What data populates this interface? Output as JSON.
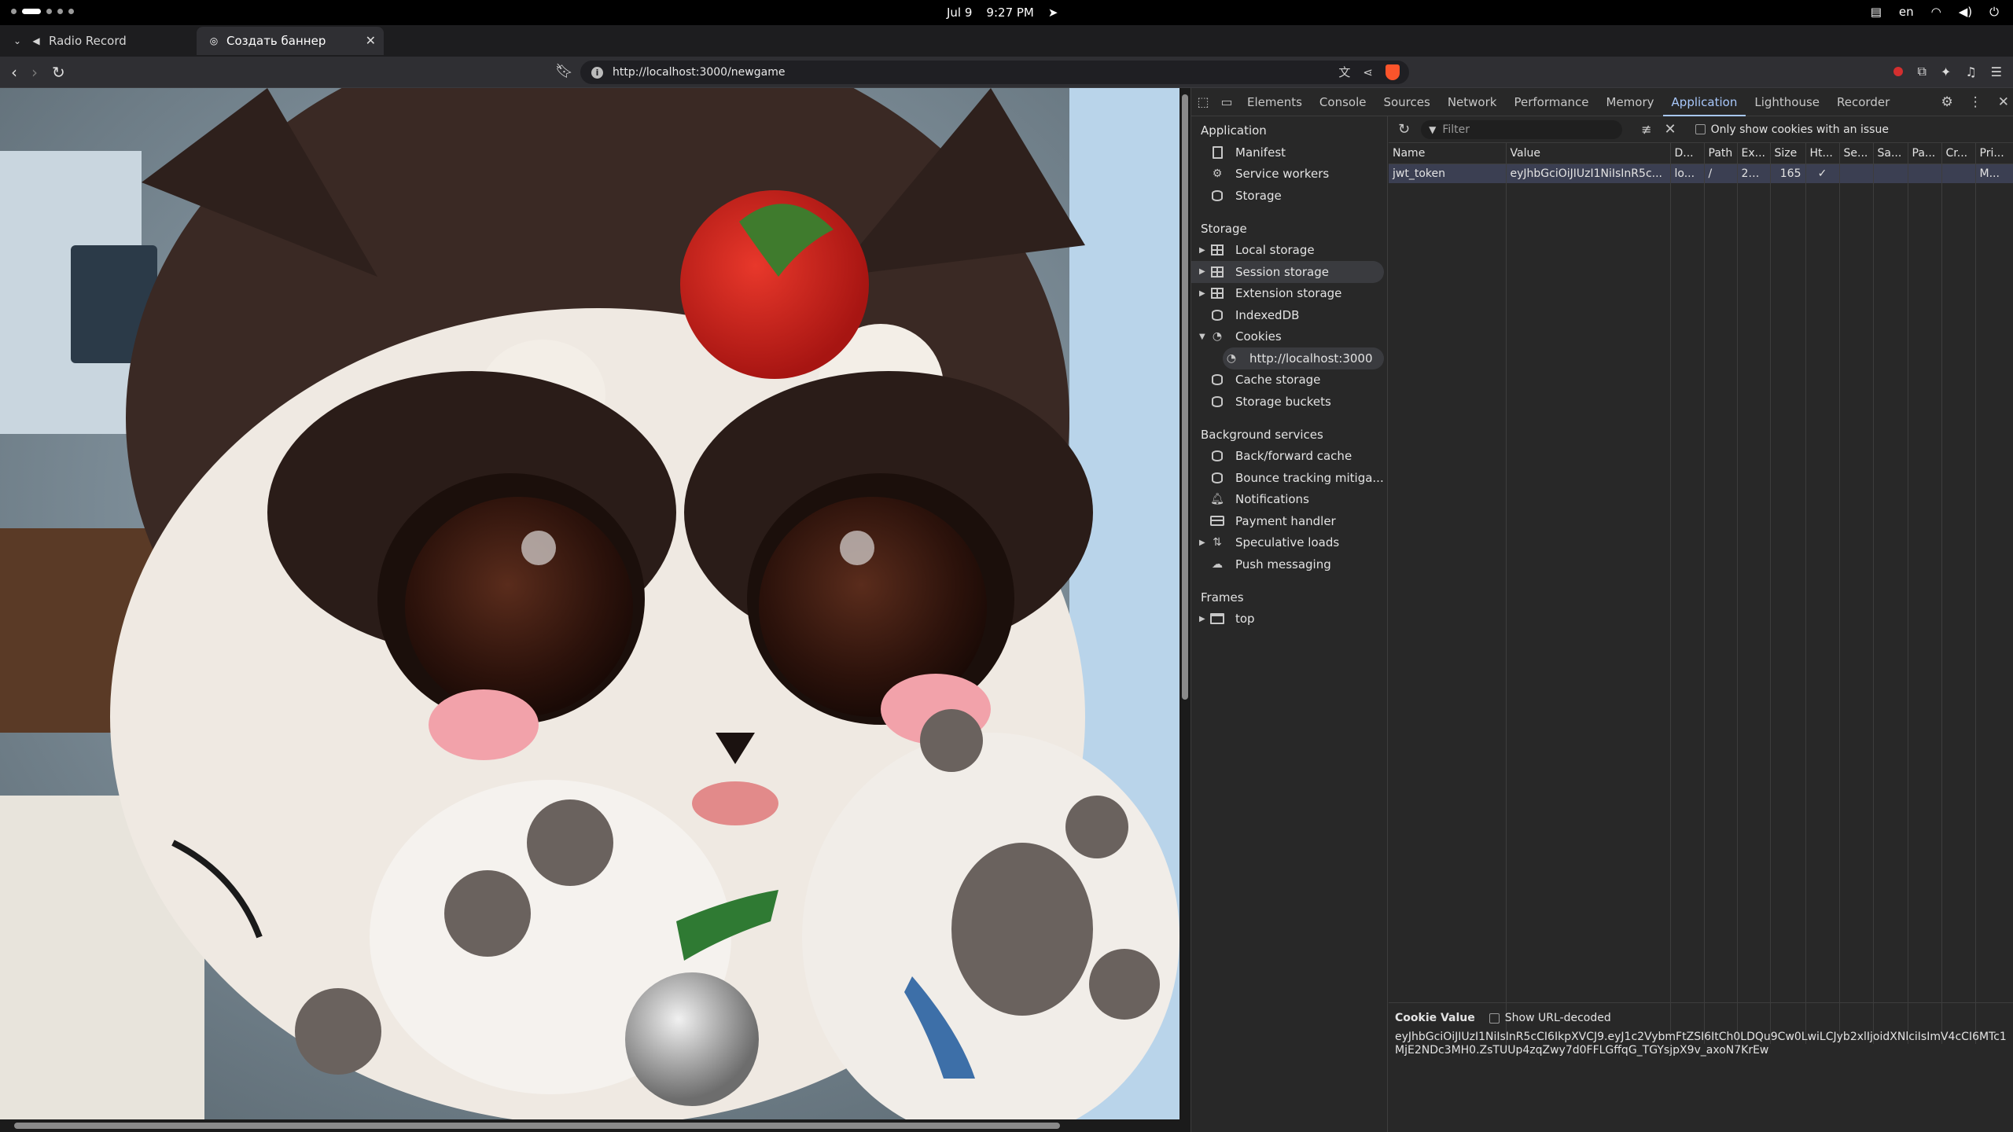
{
  "system_bar": {
    "date": "Jul 9",
    "time": "9:27 PM",
    "language": "en"
  },
  "tabs": [
    {
      "title": "Radio Record",
      "active": false
    },
    {
      "title": "Создать баннер",
      "active": true
    }
  ],
  "address_bar": {
    "url": "http://localhost:3000/newgame"
  },
  "devtools": {
    "tabs": [
      "Elements",
      "Console",
      "Sources",
      "Network",
      "Performance",
      "Memory",
      "Application",
      "Lighthouse",
      "Recorder"
    ],
    "active_tab": "Application",
    "sidebar": {
      "application": {
        "heading": "Application",
        "items": [
          "Manifest",
          "Service workers",
          "Storage"
        ]
      },
      "storage": {
        "heading": "Storage",
        "items": [
          "Local storage",
          "Session storage",
          "Extension storage",
          "IndexedDB",
          "Cookies",
          "http://localhost:3000",
          "Cache storage",
          "Storage buckets"
        ]
      },
      "background": {
        "heading": "Background services",
        "items": [
          "Back/forward cache",
          "Bounce tracking mitiga...",
          "Notifications",
          "Payment handler",
          "Speculative loads",
          "Push messaging"
        ]
      },
      "frames": {
        "heading": "Frames",
        "items": [
          "top"
        ]
      }
    },
    "toolbar": {
      "filter_placeholder": "Filter",
      "only_issues_label": "Only show cookies with an issue"
    },
    "cookie_table": {
      "columns": [
        "Name",
        "Value",
        "D...",
        "Path",
        "Ex...",
        "Size",
        "Ht...",
        "Se...",
        "Sa...",
        "Pa...",
        "Cr...",
        "Pri..."
      ],
      "rows": [
        [
          "jwt_token",
          "eyJhbGciOiJIUzI1NiIsInR5c...",
          "lo...",
          "/",
          "20...",
          "165",
          "✓",
          "",
          "",
          "",
          "",
          "M..."
        ]
      ]
    },
    "cookie_value": {
      "heading": "Cookie Value",
      "show_decoded_label": "Show URL-decoded",
      "value": "eyJhbGciOiJIUzI1NiIsInR5cCI6IkpXVCJ9.eyJ1c2VybmFtZSI6ItCh0LDQu9Cw0LwiLCJyb2xlIjoidXNlciIsImV4cCI6MTc1MjE2NDc3MH0.ZsTUUp4zqZwy7d0FFLGffqG_TGYsjpX9v_axoN7KrEw"
    }
  },
  "colors": {
    "accent": "#a8c7fa",
    "selected_row": "#3b3f52",
    "devtools_bg": "#282828"
  }
}
